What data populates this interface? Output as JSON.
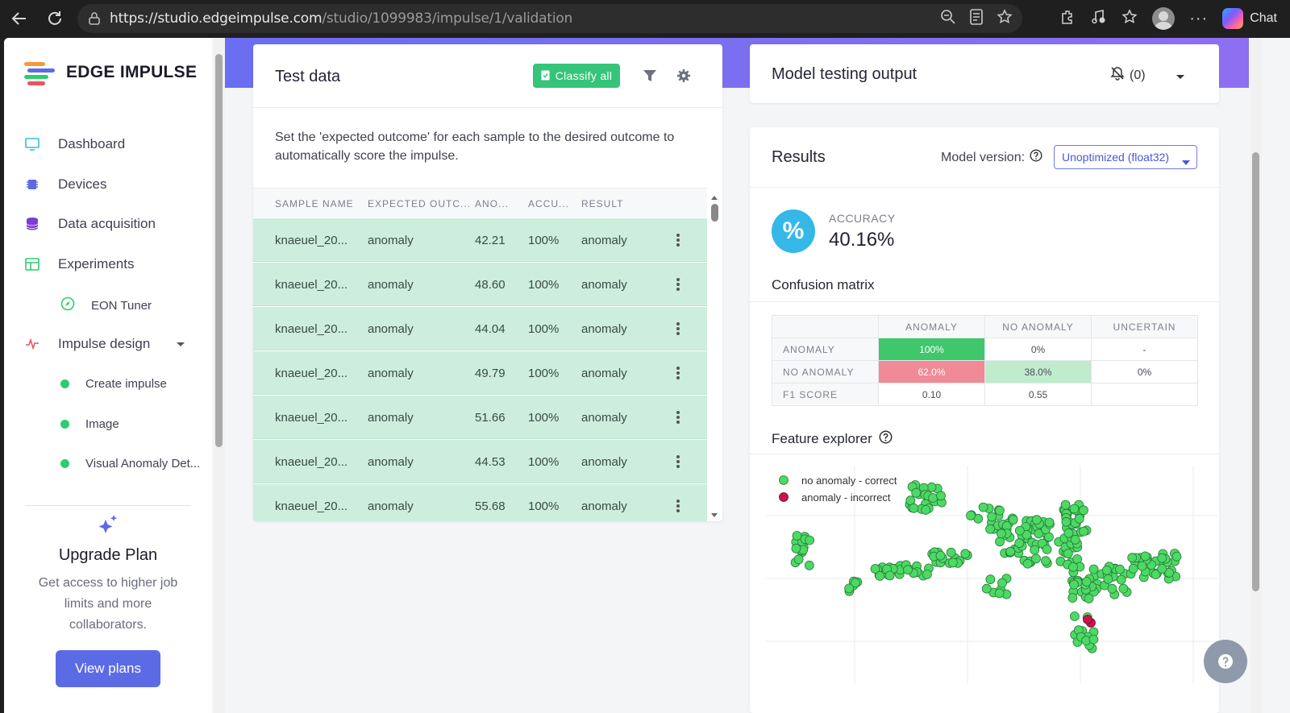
{
  "browser": {
    "url_host": "https://studio.edgeimpulse.com",
    "url_path": "/studio/1099983/impulse/1/validation",
    "chat_label": "Chat"
  },
  "sidebar": {
    "brand": "EDGE IMPULSE",
    "items": [
      {
        "label": "Dashboard",
        "icon": "monitor-icon"
      },
      {
        "label": "Devices",
        "icon": "chip-icon"
      },
      {
        "label": "Data acquisition",
        "icon": "database-icon"
      },
      {
        "label": "Experiments",
        "icon": "table-icon"
      }
    ],
    "eon_tuner": "EON Tuner",
    "impulse_design": "Impulse design",
    "impulse_subitems": [
      "Create impulse",
      "Image",
      "Visual Anomaly Det..."
    ],
    "upgrade": {
      "title": "Upgrade Plan",
      "text": "Get access to higher job limits and more collaborators.",
      "button": "View plans"
    }
  },
  "test_data": {
    "title": "Test data",
    "classify_all": "Classify all",
    "description": "Set the 'expected outcome' for each sample to the desired outcome to automatically score the impulse.",
    "columns": [
      "SAMPLE NAME",
      "EXPECTED OUTC...",
      "ANO...",
      "ACCU...",
      "RESULT"
    ],
    "rows": [
      {
        "name": "knaeuel_20...",
        "expected": "anomaly",
        "score": "42.21",
        "accuracy": "100%",
        "result": "anomaly"
      },
      {
        "name": "knaeuel_20...",
        "expected": "anomaly",
        "score": "48.60",
        "accuracy": "100%",
        "result": "anomaly"
      },
      {
        "name": "knaeuel_20...",
        "expected": "anomaly",
        "score": "44.04",
        "accuracy": "100%",
        "result": "anomaly"
      },
      {
        "name": "knaeuel_20...",
        "expected": "anomaly",
        "score": "49.79",
        "accuracy": "100%",
        "result": "anomaly"
      },
      {
        "name": "knaeuel_20...",
        "expected": "anomaly",
        "score": "51.66",
        "accuracy": "100%",
        "result": "anomaly"
      },
      {
        "name": "knaeuel_20...",
        "expected": "anomaly",
        "score": "44.53",
        "accuracy": "100%",
        "result": "anomaly"
      },
      {
        "name": "knaeuel_20...",
        "expected": "anomaly",
        "score": "55.68",
        "accuracy": "100%",
        "result": "anomaly"
      }
    ]
  },
  "output": {
    "title": "Model testing output",
    "notifications": "(0)"
  },
  "results": {
    "title": "Results",
    "model_version_label": "Model version:",
    "model_version": "Unoptimized (float32)",
    "accuracy_label": "ACCURACY",
    "accuracy_value": "40.16%",
    "confusion_title": "Confusion matrix",
    "cm_headers": [
      "ANOMALY",
      "NO ANOMALY",
      "UNCERTAIN"
    ],
    "cm_rows": [
      {
        "label": "ANOMALY",
        "cells": [
          "100%",
          "0%",
          "-"
        ]
      },
      {
        "label": "NO ANOMALY",
        "cells": [
          "62.0%",
          "38.0%",
          "0%"
        ]
      },
      {
        "label": "F1 SCORE",
        "cells": [
          "0.10",
          "0.55",
          ""
        ]
      }
    ],
    "feature_explorer_title": "Feature explorer",
    "legend": [
      "no anomaly - correct",
      "anomaly - incorrect"
    ],
    "colors": {
      "correct": "#4cd964",
      "incorrect": "#c8154f",
      "accent": "#5b6be6",
      "row_bg": "#cdeedd"
    }
  }
}
